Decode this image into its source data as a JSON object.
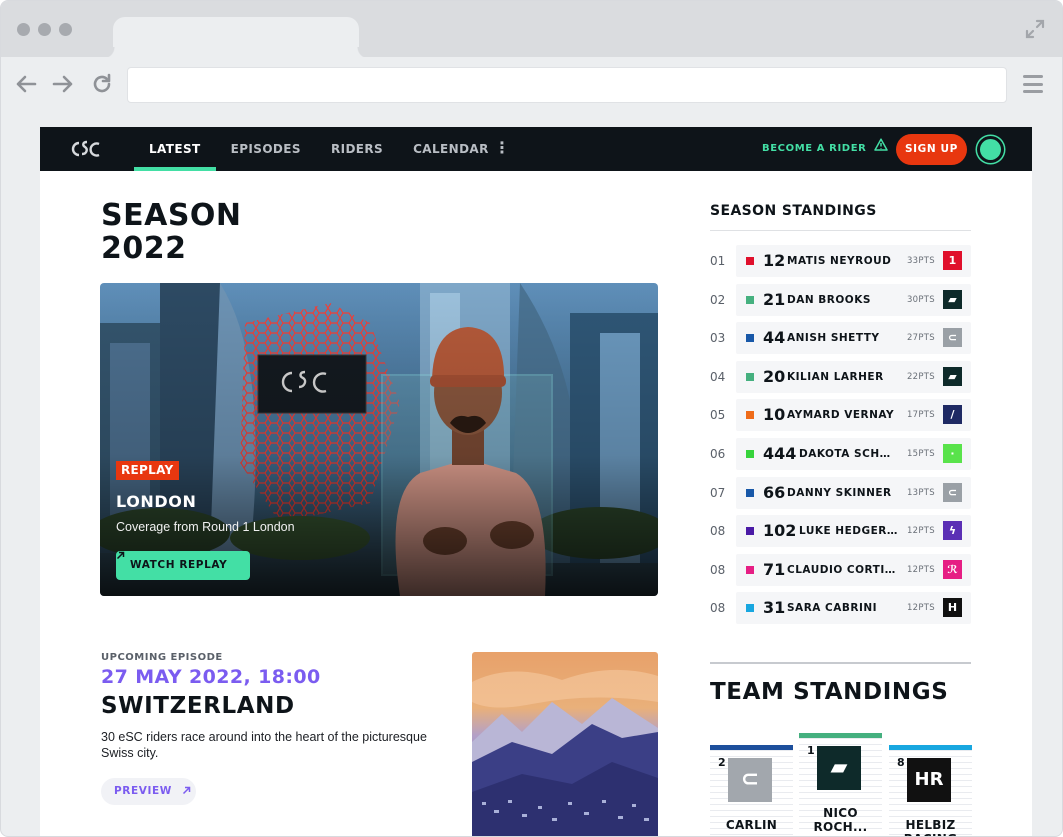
{
  "browser": {
    "url": "",
    "icons": [
      "window-dots",
      "back-arrow-icon",
      "forward-arrow-icon",
      "reload-icon",
      "expand-icon",
      "menu-icon"
    ]
  },
  "nav": {
    "logo_icon": "esc-logo-icon",
    "links": [
      "LATEST",
      "EPISODES",
      "RIDERS",
      "CALENDAR"
    ],
    "active_link": "LATEST",
    "more_icon": "vertical-dots-icon",
    "become_rider": "BECOME A RIDER",
    "become_rider_icon": "warning-triangle-icon",
    "sign_up": "SIGN UP",
    "accent_color": "#43dfa5",
    "signup_color": "#e8370f",
    "background": "#0e1419"
  },
  "season": {
    "title_line1": "SEASON",
    "title_line2": "2022"
  },
  "hero": {
    "badge": "REPLAY",
    "title": "LONDON",
    "subtitle": "Coverage from Round 1 London",
    "button": "WATCH REPLAY",
    "button_icon": "arrow-up-right-icon"
  },
  "upcoming": {
    "label": "UPCOMING EPISODE",
    "date": "27 MAY 2022, 18:00",
    "title": "SWITZERLAND",
    "description": "30 eSC riders race around into the heart of the picturesque Swiss city.",
    "button": "PREVIEW",
    "button_icon": "arrow-up-right-icon"
  },
  "season_standings": {
    "title": "SEASON STANDINGS",
    "rows": [
      {
        "pos": "01",
        "number": "12",
        "name": "MATIS NEYROUD",
        "points": "33PTS",
        "color": "#e0102c",
        "team_color": "#e0102c",
        "team_mark": "1"
      },
      {
        "pos": "02",
        "number": "21",
        "name": "DAN BROOKS",
        "points": "30PTS",
        "color": "#45b07f",
        "team_color": "#0e2a2a",
        "team_mark": "▰"
      },
      {
        "pos": "03",
        "number": "44",
        "name": "ANISH SHETTY",
        "points": "27PTS",
        "color": "#1858a8",
        "team_color": "#9aa0a6",
        "team_mark": "⊂"
      },
      {
        "pos": "04",
        "number": "20",
        "name": "KILIAN LARHER",
        "points": "22PTS",
        "color": "#45b07f",
        "team_color": "#0e2a2a",
        "team_mark": "▰"
      },
      {
        "pos": "05",
        "number": "10",
        "name": "AYMARD VERNAY",
        "points": "17PTS",
        "color": "#ef6c1a",
        "team_color": "#1f2a64",
        "team_mark": "/"
      },
      {
        "pos": "06",
        "number": "444",
        "name": "DAKOTA SCHUETZ",
        "points": "15PTS",
        "color": "#37d43c",
        "team_color": "#59e34b",
        "team_mark": "·"
      },
      {
        "pos": "07",
        "number": "66",
        "name": "DANNY SKINNER",
        "points": "13PTS",
        "color": "#1858a8",
        "team_color": "#9aa0a6",
        "team_mark": "⊂"
      },
      {
        "pos": "08",
        "number": "102",
        "name": "LUKE HEDGER ...",
        "points": "12PTS",
        "color": "#4a1aa6",
        "team_color": "#5b2fb5",
        "team_mark": "ϟ"
      },
      {
        "pos": "08",
        "number": "71",
        "name": "CLAUDIO CORTI ...",
        "points": "12PTS",
        "color": "#e61e84",
        "team_color": "#e61e84",
        "team_mark": "ℛ"
      },
      {
        "pos": "08",
        "number": "31",
        "name": "SARA CABRINI",
        "points": "12PTS",
        "color": "#18a7e0",
        "team_color": "#111111",
        "team_mark": "H"
      }
    ]
  },
  "team_standings": {
    "title": "TEAM STANDINGS",
    "teams": [
      {
        "rank": "2",
        "name": "CARLIN",
        "bar_color": "#1d4f9c",
        "logo_color": "#a2a7ad",
        "logo_mark": "⊂"
      },
      {
        "rank": "1",
        "name": "NICO ROCH...",
        "bar_color": "#45b07f",
        "logo_color": "#0e2a2a",
        "logo_mark": "▰"
      },
      {
        "rank": "8",
        "name": "HELBIZ RACING",
        "bar_color": "#18a7e0",
        "logo_color": "#111111",
        "logo_mark": "HR"
      }
    ]
  }
}
